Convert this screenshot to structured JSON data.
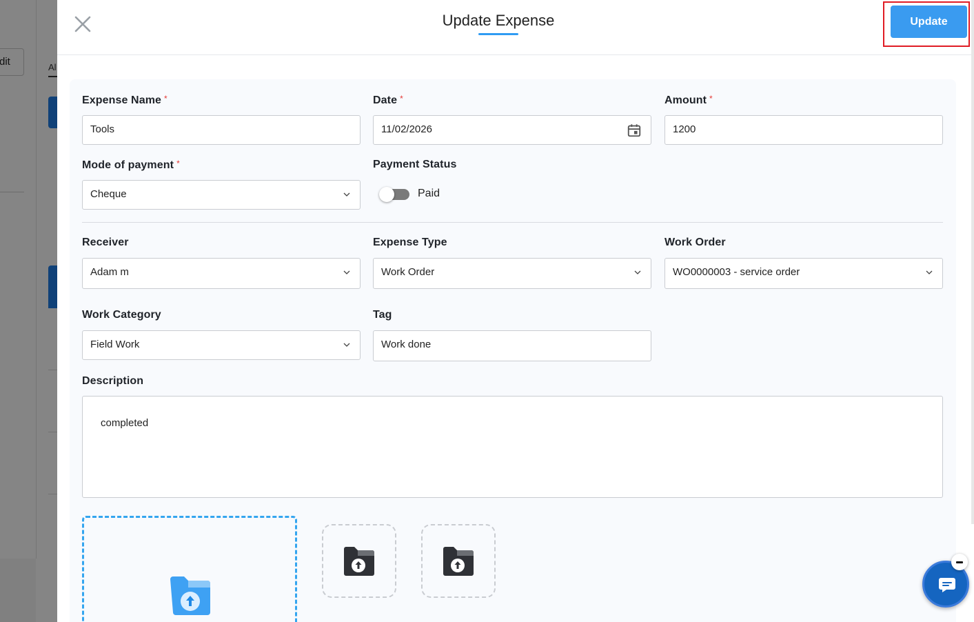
{
  "background": {
    "edit_label": "dit",
    "tab_label": "Al"
  },
  "modal": {
    "title": "Update Expense",
    "update_label": "Update"
  },
  "form": {
    "expense_name": {
      "label": "Expense Name",
      "value": "Tools",
      "required": "*"
    },
    "date": {
      "label": "Date",
      "value": "11/02/2026",
      "required": "*"
    },
    "amount": {
      "label": "Amount",
      "value": "1200",
      "required": "*"
    },
    "mode_of_payment": {
      "label": "Mode of payment",
      "value": "Cheque",
      "required": "*"
    },
    "payment_status": {
      "label": "Payment Status",
      "toggle_label": "Paid",
      "on": false
    },
    "receiver": {
      "label": "Receiver",
      "value": "Adam m"
    },
    "expense_type": {
      "label": "Expense Type",
      "value": "Work Order"
    },
    "work_order": {
      "label": "Work Order",
      "value": "WO0000003 - service order"
    },
    "work_category": {
      "label": "Work Category",
      "value": "Field Work"
    },
    "tag": {
      "label": "Tag",
      "value": "Work done"
    },
    "description": {
      "label": "Description",
      "value": "completed"
    }
  },
  "icons": {
    "close": "close-icon",
    "calendar": "calendar-icon",
    "chevron": "chevron-down-icon",
    "upload": "folder-upload-icon",
    "chat": "chat-icon"
  },
  "colors": {
    "accent": "#3a9bf0",
    "required": "#e53935",
    "highlight": "#e01b24",
    "chat": "#1565c0"
  }
}
